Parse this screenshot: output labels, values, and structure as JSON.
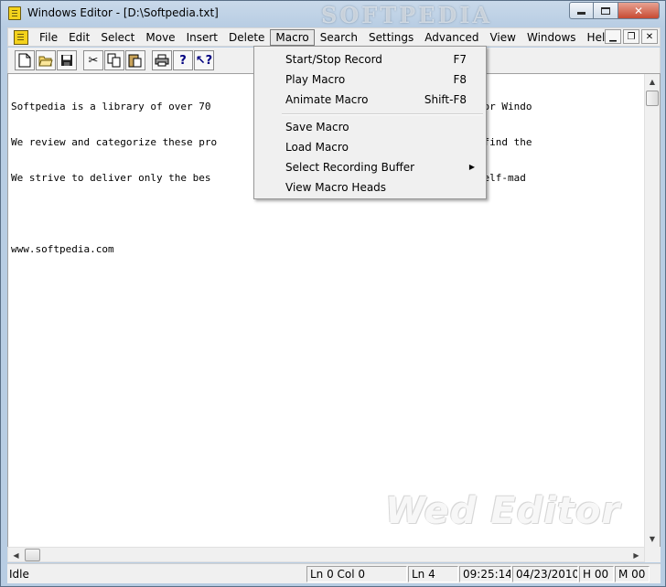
{
  "window": {
    "title": "Windows Editor - [D:\\Softpedia.txt]",
    "watermark": "SOFTPEDIA"
  },
  "menubar": {
    "items": [
      "File",
      "Edit",
      "Select",
      "Move",
      "Insert",
      "Delete",
      "Macro",
      "Search",
      "Settings",
      "Advanced",
      "View",
      "Windows",
      "Help"
    ],
    "active": "Macro"
  },
  "toolbar": {
    "buttons": [
      "new-file-icon",
      "open-folder-icon",
      "save-icon",
      "cut-icon",
      "copy-icon",
      "paste-icon",
      "print-icon",
      "help-icon",
      "context-help-icon"
    ]
  },
  "editor": {
    "lines": [
      "Softpedia is a library of over 70                                re programs for Windo",
      "We review and categorize these pro                               itor/user to find the",
      "We strive to deliver only the bes                               ogether with self-mad",
      "",
      "www.softpedia.com"
    ],
    "watermark": "Wed Editor"
  },
  "macro_menu": {
    "items": [
      {
        "label": "Start/Stop Record",
        "shortcut": "F7"
      },
      {
        "label": "Play Macro",
        "shortcut": "F8"
      },
      {
        "label": "Animate Macro",
        "shortcut": "Shift-F8"
      },
      {
        "label": "Save Macro",
        "shortcut": ""
      },
      {
        "label": "Load Macro",
        "shortcut": ""
      },
      {
        "label": "Select Recording Buffer",
        "shortcut": "",
        "submenu": true
      },
      {
        "label": "View Macro Heads",
        "shortcut": ""
      }
    ]
  },
  "statusbar": {
    "state": "Idle",
    "position": "Ln 0 Col 0",
    "lines": "Ln 4",
    "time": "09:25:14",
    "date": "04/23/2010",
    "h": "H 00",
    "m": "M 00"
  }
}
